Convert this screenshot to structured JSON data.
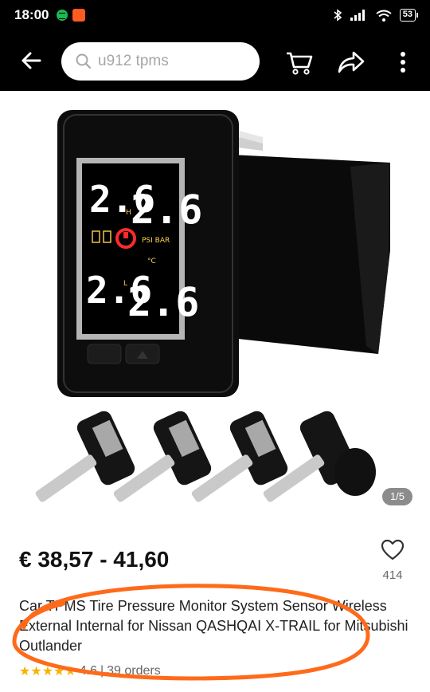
{
  "status_bar": {
    "time": "18:00",
    "battery": "53"
  },
  "toolbar": {
    "search_value": "",
    "search_placeholder": "u912 tpms"
  },
  "gallery": {
    "counter": "1/5",
    "display_top": "2.6",
    "display_top_b": "2.6",
    "display_bottom": "2.6",
    "display_bottom_b": "2.6",
    "units": "PSI BAR",
    "celsius": "°C",
    "h_mark": "H",
    "l_mark": "L"
  },
  "product": {
    "price": "€ 38,57 - 41,60",
    "wishlist_count": "414",
    "title": "Car TPMS Tire Pressure Monitor System Sensor Wireless External Internal for Nissan QASHQAI X-TRAIL for Mitsubishi Outlander",
    "rating": "4.6",
    "separator": "|",
    "orders": "39 orders",
    "stars": "★★★★★"
  },
  "colors": {
    "accent_orange": "#ff6a1a",
    "star": "#f5b400",
    "bar": "#000000"
  }
}
